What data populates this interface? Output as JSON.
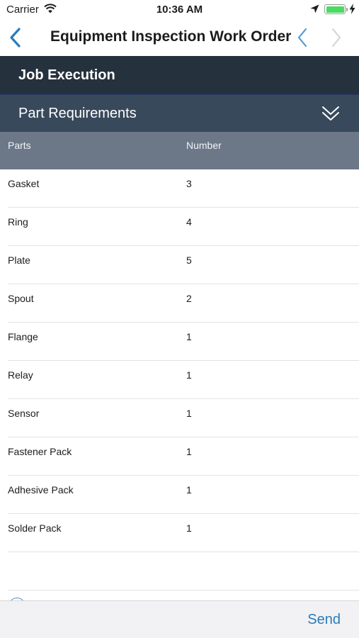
{
  "status_bar": {
    "carrier": "Carrier",
    "time": "10:36 AM",
    "wifi_icon": "wifi-icon",
    "location_icon": "location-arrow-icon",
    "battery_icon": "battery-full-icon",
    "charging_icon": "charging-bolt-icon"
  },
  "nav": {
    "title": "Equipment Inspection Work Order",
    "back_icon": "chevron-left-icon",
    "prev_icon": "chevron-left-icon",
    "next_icon": "chevron-right-icon"
  },
  "section": {
    "title": "Job Execution"
  },
  "subsection": {
    "title": "Part Requirements",
    "toggle_icon": "double-chevron-down-icon"
  },
  "table": {
    "columns": [
      "Parts",
      "Number"
    ],
    "rows": [
      {
        "part": "Gasket",
        "number": "3"
      },
      {
        "part": "Ring",
        "number": "4"
      },
      {
        "part": "Plate",
        "number": "5"
      },
      {
        "part": "Spout",
        "number": "2"
      },
      {
        "part": "Flange",
        "number": "1"
      },
      {
        "part": "Relay",
        "number": "1"
      },
      {
        "part": "Sensor",
        "number": "1"
      },
      {
        "part": "Fastener Pack",
        "number": "1"
      },
      {
        "part": "Adhesive Pack",
        "number": "1"
      },
      {
        "part": "Solder Pack",
        "number": "1"
      }
    ]
  },
  "bottom_bar": {
    "send_label": "Send"
  },
  "colors": {
    "accent": "#2b7bb9",
    "section_header_bg": "#25313d",
    "subsection_header_bg": "#38495b",
    "table_header_bg": "#6c7788",
    "battery_green": "#4cd964"
  }
}
